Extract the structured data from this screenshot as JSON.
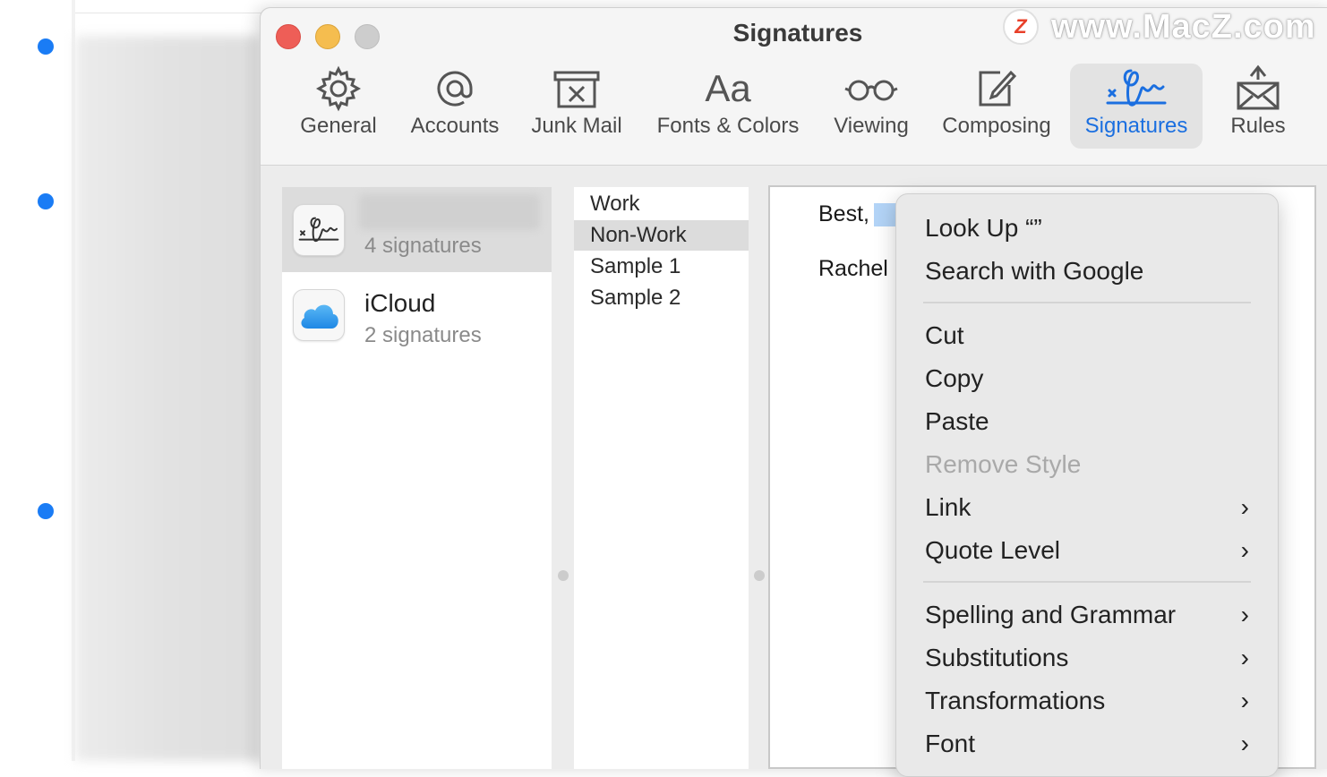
{
  "window": {
    "title": "Signatures"
  },
  "toolbar": {
    "items": [
      {
        "label": "General",
        "icon": "gear-icon",
        "active": false
      },
      {
        "label": "Accounts",
        "icon": "at-icon",
        "active": false
      },
      {
        "label": "Junk Mail",
        "icon": "junk-mail-icon",
        "active": false
      },
      {
        "label": "Fonts & Colors",
        "icon": "fonts-icon",
        "active": false
      },
      {
        "label": "Viewing",
        "icon": "glasses-icon",
        "active": false
      },
      {
        "label": "Composing",
        "icon": "compose-icon",
        "active": false
      },
      {
        "label": "Signatures",
        "icon": "signature-icon",
        "active": true
      },
      {
        "label": "Rules",
        "icon": "rules-icon",
        "active": false
      }
    ],
    "accent_color": "#1b6fe0"
  },
  "accounts": [
    {
      "name": "",
      "count": "4 signatures",
      "icon": "signature-icon",
      "selected": true
    },
    {
      "name": "iCloud",
      "count": "2 signatures",
      "icon": "icloud-icon",
      "selected": false
    }
  ],
  "signatures": [
    {
      "name": "Work",
      "selected": false
    },
    {
      "name": "Non-Work",
      "selected": true
    },
    {
      "name": "Sample 1",
      "selected": false
    },
    {
      "name": "Sample 2",
      "selected": false
    }
  ],
  "editor": {
    "line1": "Best,",
    "line2": "Rachel"
  },
  "context_menu": {
    "items": [
      {
        "label": "Look Up “”",
        "disabled": false,
        "submenu": false
      },
      {
        "label": "Search with Google",
        "disabled": false,
        "submenu": false
      },
      {
        "label": "Cut",
        "disabled": false,
        "submenu": false
      },
      {
        "label": "Copy",
        "disabled": false,
        "submenu": false
      },
      {
        "label": "Paste",
        "disabled": false,
        "submenu": false
      },
      {
        "label": "Remove Style",
        "disabled": true,
        "submenu": false
      },
      {
        "label": "Link",
        "disabled": false,
        "submenu": true
      },
      {
        "label": "Quote Level",
        "disabled": false,
        "submenu": true
      },
      {
        "label": "Spelling and Grammar",
        "disabled": false,
        "submenu": true
      },
      {
        "label": "Substitutions",
        "disabled": false,
        "submenu": true
      },
      {
        "label": "Transformations",
        "disabled": false,
        "submenu": true
      },
      {
        "label": "Font",
        "disabled": false,
        "submenu": true
      }
    ]
  },
  "watermark": {
    "badge": "Z",
    "text": "www.MacZ.com"
  },
  "colors": {
    "unread_dot": "#1a7cf5",
    "close": "#ee5e57",
    "minimize": "#f5bd4f",
    "maximize": "#cdcdcd"
  }
}
